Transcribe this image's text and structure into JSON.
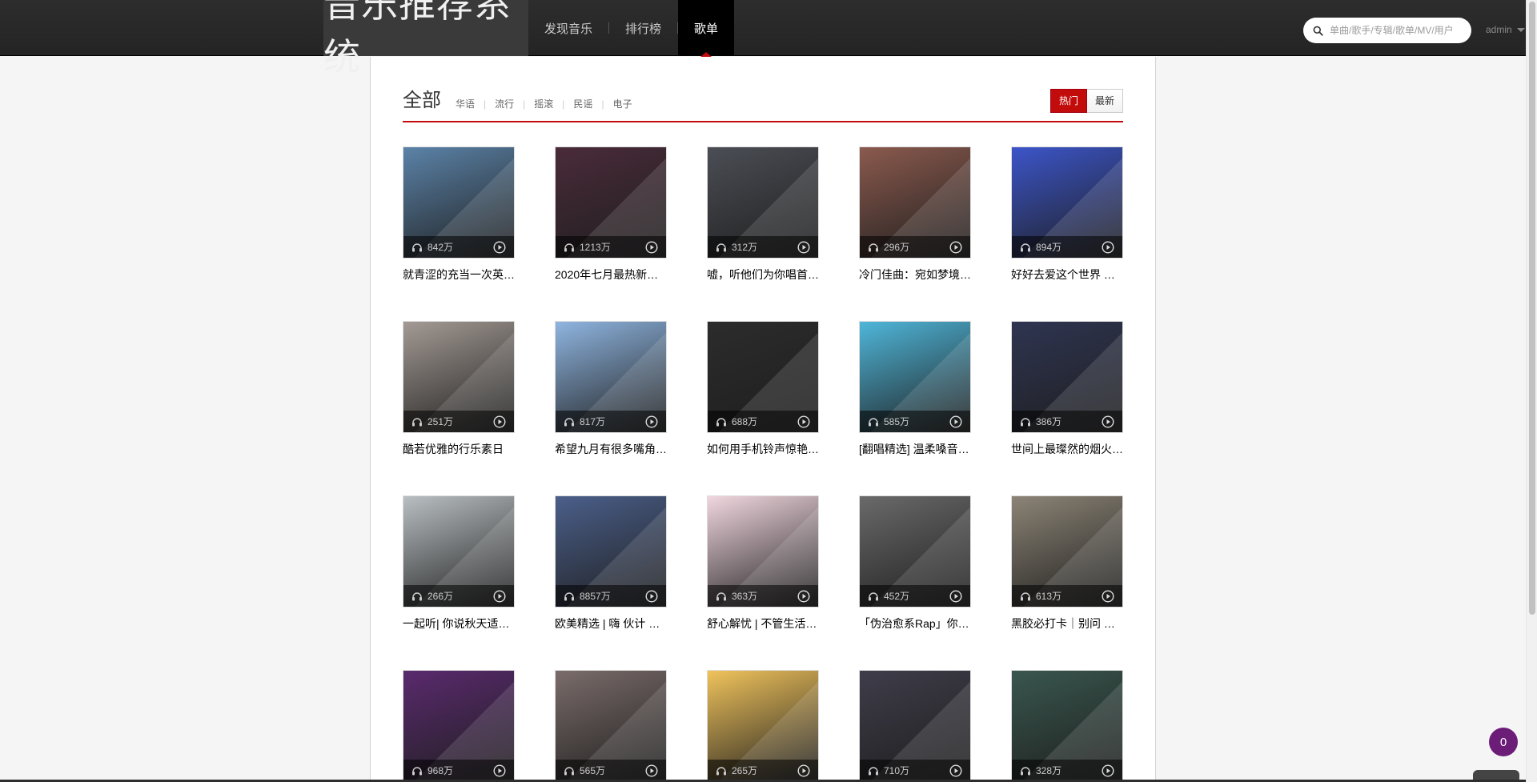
{
  "logo": {
    "text": "音乐推荐系统"
  },
  "nav": {
    "items": [
      {
        "label": "发现音乐"
      },
      {
        "label": "排行榜"
      },
      {
        "label": "歌单"
      }
    ]
  },
  "search": {
    "placeholder": "单曲/歌手/专辑/歌单/MV/用户"
  },
  "user": {
    "name": "admin"
  },
  "header": {
    "title": "全部",
    "categories": [
      "华语",
      "流行",
      "摇滚",
      "民谣",
      "电子"
    ],
    "sort": {
      "hot": "热门",
      "new": "最新"
    }
  },
  "playlists": [
    {
      "title": "就青涩的充当一次英…",
      "count": "842万",
      "color": "#5b83a8"
    },
    {
      "title": "2020年七月最热新…",
      "count": "1213万",
      "color": "#4a2b3a"
    },
    {
      "title": "嘘，听他们为你唱首…",
      "count": "312万",
      "color": "#4b4e55"
    },
    {
      "title": "冷门佳曲：宛如梦境…",
      "count": "296万",
      "color": "#8b5a4e"
    },
    {
      "title": "好好去爱这个世界 …",
      "count": "894万",
      "color": "#3c55c9"
    },
    {
      "title": "酷若优雅的行乐素日",
      "count": "251万",
      "color": "#a39a94"
    },
    {
      "title": "希望九月有很多嘴角…",
      "count": "817万",
      "color": "#8fb5e0"
    },
    {
      "title": "如何用手机铃声惊艳…",
      "count": "688万",
      "color": "#2c2c2c"
    },
    {
      "title": "[翻唱精选] 温柔嗓音…",
      "count": "585万",
      "color": "#4fb6d9"
    },
    {
      "title": "世间上最璨然的烟火…",
      "count": "386万",
      "color": "#2f3552"
    },
    {
      "title": "一起听| 你说秋天适…",
      "count": "266万",
      "color": "#b9bfc2"
    },
    {
      "title": "欧美精选 | 嗨 伙计 …",
      "count": "8857万",
      "color": "#4b5f8a"
    },
    {
      "title": "舒心解忧 | 不管生活…",
      "count": "363万",
      "color": "#f1d7df"
    },
    {
      "title": "「伪治愈系Rap」你…",
      "count": "452万",
      "color": "#6a6a6a"
    },
    {
      "title": "黑胶必打卡｜别问 …",
      "count": "613万",
      "color": "#8c8476"
    },
    {
      "title": "",
      "count": "968万",
      "color": "#5a2a6e"
    },
    {
      "title": "",
      "count": "565万",
      "color": "#7a6c6a"
    },
    {
      "title": "",
      "count": "265万",
      "color": "#f0c35c"
    },
    {
      "title": "",
      "count": "710万",
      "color": "#3f3d4a"
    },
    {
      "title": "",
      "count": "328万",
      "color": "#39574e"
    }
  ],
  "badge": {
    "count": "0"
  }
}
